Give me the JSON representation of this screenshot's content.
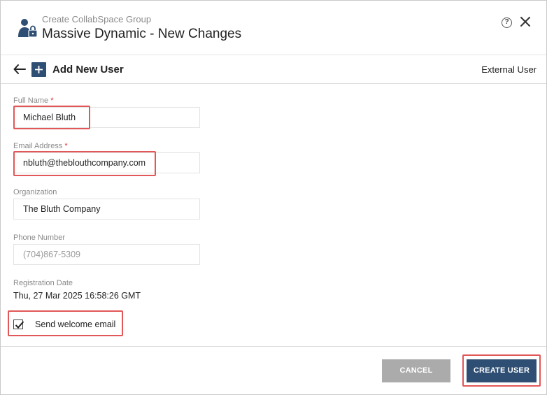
{
  "header": {
    "subtitle": "Create CollabSpace Group",
    "title": "Massive Dynamic - New Changes",
    "help_glyph": "?",
    "icons": [
      "user-lock-icon",
      "help-icon",
      "close-icon"
    ]
  },
  "subbar": {
    "title": "Add New User",
    "external_link": "External User",
    "icons": [
      "back-arrow-icon",
      "plus-icon"
    ]
  },
  "form": {
    "full_name": {
      "label": "Full Name",
      "required": "*",
      "value": "Michael Bluth"
    },
    "email": {
      "label": "Email Address",
      "required": "*",
      "value": "nbluth@theblouthcompany.com"
    },
    "organization": {
      "label": "Organization",
      "value": "The Bluth Company"
    },
    "phone": {
      "label": "Phone Number",
      "placeholder": "(704)867-5309"
    },
    "registration": {
      "label": "Registration Date",
      "value": "Thu, 27 Mar 2025 16:58:26 GMT"
    },
    "welcome_email": {
      "label": "Send welcome email",
      "checked": true
    }
  },
  "footer": {
    "cancel_label": "CANCEL",
    "create_label": "CREATE USER"
  },
  "colors": {
    "primary": "#2e4e73",
    "cancel": "#ababab",
    "highlight": "#e25757",
    "required": "#dd3333"
  }
}
